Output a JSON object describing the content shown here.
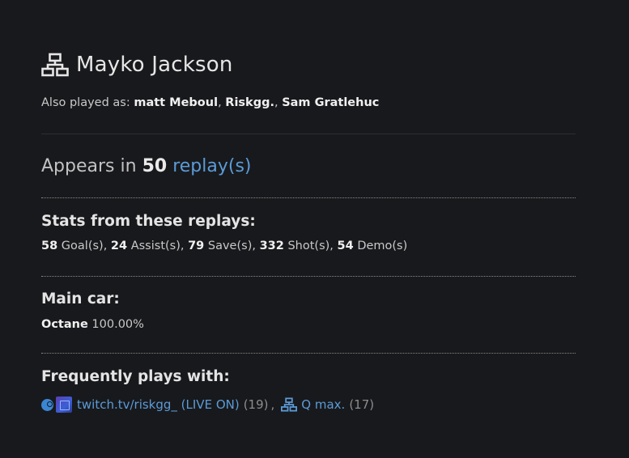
{
  "player": {
    "name": "Mayko Jackson",
    "icon": "network-icon"
  },
  "aliases": {
    "label": "Also played as:",
    "names": [
      "matt Meboul",
      "Riskgg.",
      "Sam Gratlehuc"
    ]
  },
  "appears": {
    "prefix": "Appears in",
    "count": "50",
    "link_text": "replay(s)"
  },
  "stats": {
    "title": "Stats from these replays:",
    "items": [
      {
        "value": "58",
        "label": "Goal(s)"
      },
      {
        "value": "24",
        "label": "Assist(s)"
      },
      {
        "value": "79",
        "label": "Save(s)"
      },
      {
        "value": "332",
        "label": "Shot(s)"
      },
      {
        "value": "54",
        "label": "Demo(s)"
      }
    ]
  },
  "main_car": {
    "title": "Main car:",
    "car": "Octane",
    "percent": "100.00%"
  },
  "frequent": {
    "title": "Frequently plays with:",
    "players": [
      {
        "icons": [
          "steam-icon",
          "avatar"
        ],
        "name": "twitch.tv/riskgg_ (LIVE ON)",
        "count": "(19)"
      },
      {
        "icons": [
          "network-icon"
        ],
        "name": "Q max.",
        "count": "(17)"
      }
    ]
  },
  "colors": {
    "background": "#18191c",
    "link": "#5b9bd8",
    "text": "#d6d6d6"
  }
}
